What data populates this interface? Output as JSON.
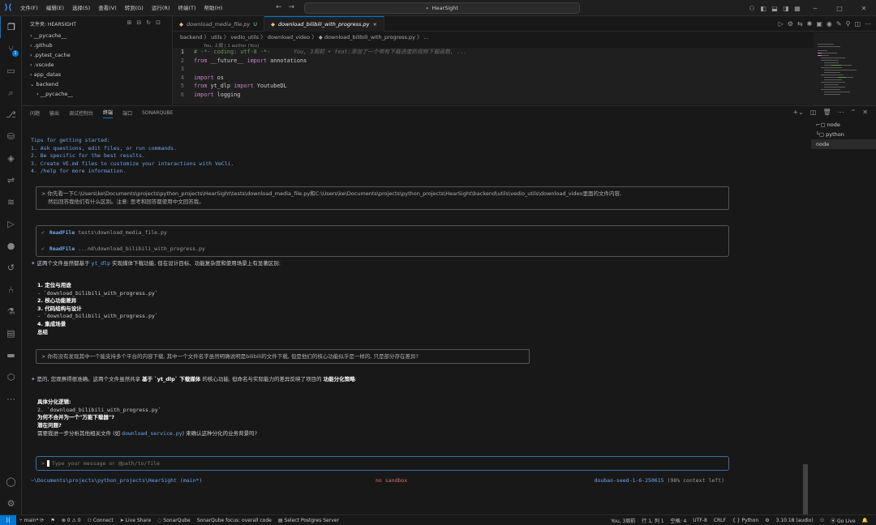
{
  "titlebar": {
    "menu": [
      "文件(F)",
      "编辑(E)",
      "选择(S)",
      "查看(V)",
      "转到(G)",
      "运行(R)",
      "终端(T)",
      "帮助(H)"
    ],
    "search": "HearSight"
  },
  "sidebar": {
    "header": "文件夹: HEARSIGHT",
    "items": [
      "__pycache__",
      ".github",
      ".pytest_cache",
      ".vscode",
      "app_datas",
      "backend",
      "__pycache__"
    ]
  },
  "tabs": [
    {
      "label": "download_media_file.py",
      "mod": "U"
    },
    {
      "label": "download_bilibili_with_progress.py",
      "mod": "×"
    }
  ],
  "breadcrumb": "backend 〉 utils 〉 vedio_utils 〉 download_video 〉 ◆ download_bilibili_with_progress.py 〉 ...",
  "editor": {
    "blame": "You, 上周 | 1 author (You)",
    "lines": [
      {
        "n": "1",
        "code": "# -*- coding: utf-8 -*-",
        "ghost": "       You, 3周前 • feat:添加了一个带有下载进度的视频下载函数, ..."
      },
      {
        "n": "2",
        "kw": "from",
        "a": " __future__ ",
        "kw2": "import",
        "b": " annotations"
      },
      {
        "n": "3",
        "code": ""
      },
      {
        "n": "4",
        "kw": "import",
        "a": " os",
        "kw2": "",
        "b": ""
      },
      {
        "n": "5",
        "kw": "from",
        "a": " yt_dlp ",
        "kw2": "import",
        "b": " YoutubeDL"
      },
      {
        "n": "6",
        "kw": "import",
        "a": " logging",
        "kw2": "",
        "b": ""
      }
    ]
  },
  "panel": {
    "tabs": [
      "问题",
      "输出",
      "调试控制台",
      "终端",
      "端口",
      "SONARQUBE"
    ],
    "active_tab": "终端",
    "terminals": [
      "node",
      "python",
      "node"
    ]
  },
  "chat": {
    "tips_title": "Tips for getting started:",
    "tips": [
      "1. Ask questions, edit files, or run commands.",
      "2. Be specific for the best results.",
      "3. Create VE.md files to customize your interactions with VeCli.",
      "4. /help for more information."
    ],
    "q1_line1": "> 你先看一下C:\\Users\\ke\\Documents\\projects\\python_projects\\HearSight\\tests\\download_media_file.py和C:\\Users\\ke\\Documents\\projects\\python_projects\\HearSight\\backend\\utils\\vedio_utils\\download_video里面的文件内容,",
    "q1_line2": "然后回答我他们有什么区别。注意: 思考和回答都使用中文回答我。",
    "tool1_name": "ReadFile",
    "tool1_arg": "tests\\download_media_file.py",
    "tool2_name": "ReadFile",
    "tool2_arg": "...nd\\download_bilibili_with_progress.py",
    "a1_pre": "这两个文件虽然都基于 ",
    "a1_code": "yt_dlp",
    "a1_post": " 实现媒体下载功能, 但在设计目标、功能复杂度和使用场景上有显著区别:",
    "list1": [
      {
        "t": "1. 定位与用途",
        "b": true
      },
      {
        "t": "  - `download_bilibili_with_progress.py`",
        "b": false
      },
      {
        "t": "2. 核心功能差异",
        "b": true
      },
      {
        "t": "3. 代码结构与设计",
        "b": true
      },
      {
        "t": "  - `download_bilibili_with_progress.py`",
        "b": false
      },
      {
        "t": "4. 集成场景",
        "b": true
      },
      {
        "t": "总结",
        "b": true
      }
    ],
    "q2": "> 你有没有发现其中一个能支持多个平台的内容下载, 其中一个文件名字虽然明确说明是bilibili的文件下载, 但是他们的核心功能似乎是一样的, 只是部分存在差异?",
    "a2_pre": "是的, 您观察得很准确。这两个文件虽然共享 ",
    "a2_bold": "基于 `yt_dlp` 下载媒体",
    "a2_mid": " 的核心功能, 但命名与实际能力的差异反映了项目的 ",
    "a2_bold2": "功能分化策略",
    "a2_end": ":",
    "list2": [
      {
        "t": "具体分化逻辑:",
        "b": true
      },
      {
        "t": "  2. `download_bilibili_with_progress.py`",
        "b": false
      },
      {
        "t": "为何不合并为一个\"万能下载器\"?",
        "b": true
      },
      {
        "t": "潜在问题?",
        "b": true
      }
    ],
    "last_pre": "需要我进一步分析其他相关文件 (如 ",
    "last_code": "download_service.py",
    "last_post": ") 来确认这种分化的业务背景吗?",
    "input_placeholder": "Type your message or @path/to/file",
    "footer_left": "~\\Documents\\projects\\python_projects\\HearSight (main*)",
    "footer_center": "no sandbox",
    "footer_model": "doubao-seed-1-6-250615",
    "footer_ctx": "(98% context left)"
  },
  "status": {
    "left": [
      "main*",
      "⊗ 0 ⚠ 0",
      "Connect",
      "Live Share",
      "SonarQube",
      "SonarQube focus: overall code",
      "Select Postgres Server"
    ],
    "right": [
      "You, 3周前",
      "行 1, 列 1",
      "空格: 4",
      "UTF-8",
      "CRLF",
      "{ } Python",
      "3.10.18 (audio)",
      "Go Live"
    ]
  }
}
